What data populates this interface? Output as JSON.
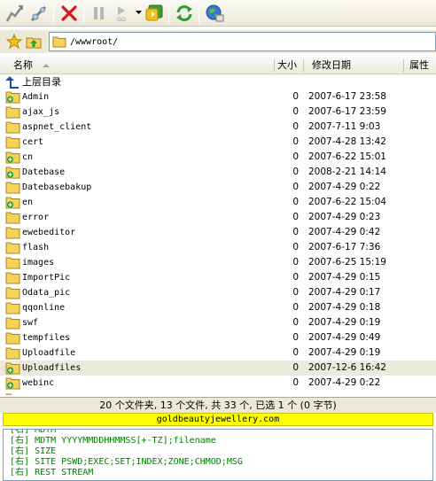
{
  "toolbar": {
    "buttons": [
      {
        "name": "connect-icon"
      },
      {
        "name": "quick-connect-icon"
      },
      {
        "name": "disconnect-icon"
      },
      {
        "name": "pause-icon"
      },
      {
        "name": "go-icon",
        "label": "GO"
      },
      {
        "name": "transfer-icon"
      },
      {
        "name": "refresh-icon"
      },
      {
        "name": "site-manager-icon"
      }
    ]
  },
  "address": {
    "path": "/wwwroot/"
  },
  "columns": {
    "name": "名称",
    "size": "大小",
    "modified": "修改日期",
    "attr": "属性"
  },
  "parent_dir": {
    "label": "上层目录"
  },
  "files": [
    {
      "name": "Admin",
      "size": "0",
      "date": "2007-6-17 23:58",
      "icon": "folder-plus"
    },
    {
      "name": "ajax_js",
      "size": "0",
      "date": "2007-6-17 23:59",
      "icon": "folder"
    },
    {
      "name": "aspnet_client",
      "size": "0",
      "date": "2007-7-11 9:03",
      "icon": "folder"
    },
    {
      "name": "cert",
      "size": "0",
      "date": "2007-4-28 13:42",
      "icon": "folder"
    },
    {
      "name": "cn",
      "size": "0",
      "date": "2007-6-22 15:01",
      "icon": "folder-plus"
    },
    {
      "name": "Datebase",
      "size": "0",
      "date": "2008-2-21 14:14",
      "icon": "folder-plus"
    },
    {
      "name": "Datebasebakup",
      "size": "0",
      "date": "2007-4-29 0:22",
      "icon": "folder"
    },
    {
      "name": "en",
      "size": "0",
      "date": "2007-6-22 15:04",
      "icon": "folder-plus"
    },
    {
      "name": "error",
      "size": "0",
      "date": "2007-4-29 0:23",
      "icon": "folder"
    },
    {
      "name": "ewebeditor",
      "size": "0",
      "date": "2007-4-29 0:42",
      "icon": "folder"
    },
    {
      "name": "flash",
      "size": "0",
      "date": "2007-6-17 7:36",
      "icon": "folder"
    },
    {
      "name": "images",
      "size": "0",
      "date": "2007-6-25 15:19",
      "icon": "folder"
    },
    {
      "name": "ImportPic",
      "size": "0",
      "date": "2007-4-29 0:15",
      "icon": "folder"
    },
    {
      "name": "Odata_pic",
      "size": "0",
      "date": "2007-4-29 0:17",
      "icon": "folder"
    },
    {
      "name": "qqonline",
      "size": "0",
      "date": "2007-4-29 0:18",
      "icon": "folder"
    },
    {
      "name": "swf",
      "size": "0",
      "date": "2007-4-29 0:19",
      "icon": "folder"
    },
    {
      "name": "tempfiles",
      "size": "0",
      "date": "2007-4-29 0:49",
      "icon": "folder"
    },
    {
      "name": "Uploadfile",
      "size": "0",
      "date": "2007-4-29 0:19",
      "icon": "folder"
    },
    {
      "name": "Uploadfiles",
      "size": "0",
      "date": "2007-12-6 16:42",
      "icon": "folder-plus",
      "selected": true
    },
    {
      "name": "webinc",
      "size": "0",
      "date": "2007-4-29 0:22",
      "icon": "folder-plus"
    }
  ],
  "status": {
    "text": "20 个文件夹, 13 个文件, 共 33 个, 已选 1 个 (0 字节)"
  },
  "site": {
    "host": "goldbeautyjewellery.com"
  },
  "log": [
    {
      "tag": "[右]",
      "text": "MDTM"
    },
    {
      "tag": "[右]",
      "text": "MDTM YYYYMMDDHHMMSS[+-TZ];filename"
    },
    {
      "tag": "[右]",
      "text": "SIZE"
    },
    {
      "tag": "[右]",
      "text": "SITE PSWD;EXEC;SET;INDEX;ZONE;CHMOD;MSG"
    },
    {
      "tag": "[右]",
      "text": "REST STREAM"
    }
  ],
  "colors": {
    "folder": "#f5d35a",
    "selected_row": "#ebeadb",
    "site_bar": "#ffff00",
    "log_text": "#008000"
  }
}
